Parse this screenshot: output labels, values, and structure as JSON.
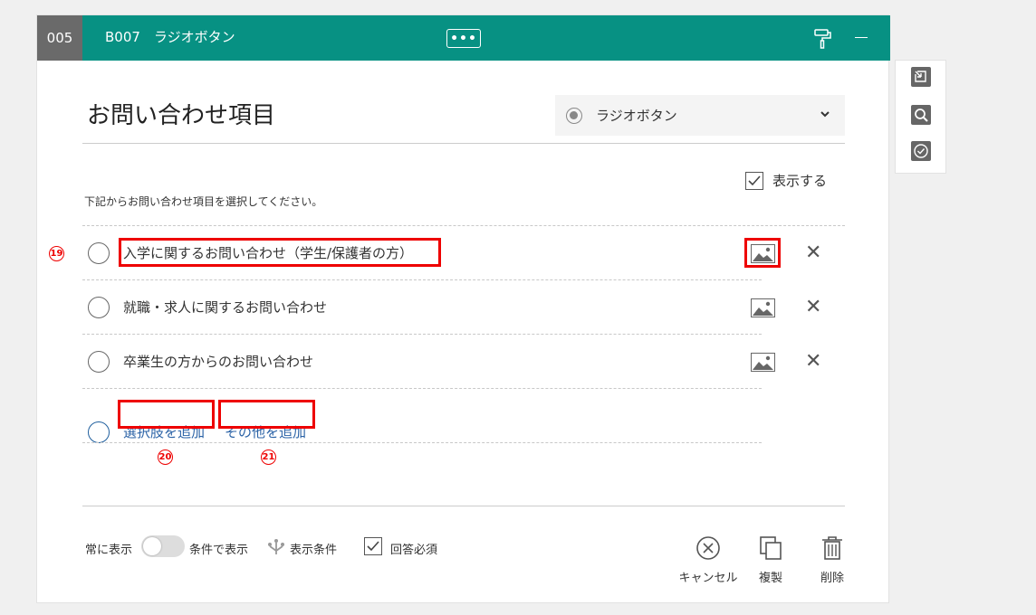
{
  "header": {
    "number": "005",
    "title": "B007　ラジオボタン",
    "more_label": "•••"
  },
  "question": {
    "title": "お問い合わせ項目",
    "type_label": "ラジオボタン",
    "display_label": "表示する",
    "description": "下記からお問い合わせ項目を選択してください。"
  },
  "options": [
    {
      "label": "入学に関するお問い合わせ（学生/保護者の方）"
    },
    {
      "label": "就職・求人に関するお問い合わせ"
    },
    {
      "label": "卒業生の方からのお問い合わせ"
    }
  ],
  "add": {
    "add_choice": "選択肢を追加",
    "add_other": "その他を追加"
  },
  "markers": {
    "m19": "19",
    "m20": "20",
    "m21": "21"
  },
  "footer": {
    "always_show": "常に表示",
    "conditional_show": "条件で表示",
    "display_condition": "表示条件",
    "required": "回答必須",
    "cancel": "キャンセル",
    "duplicate": "複製",
    "delete": "削除"
  },
  "colors": {
    "header": "#079183",
    "number_box": "#6a6a6a",
    "highlight": "#e00000",
    "link": "#2a62a6"
  },
  "icons": {
    "option_image": "image-icon",
    "option_remove": "close-icon",
    "side": [
      "import-icon",
      "search-icon",
      "check-circle-icon"
    ]
  }
}
